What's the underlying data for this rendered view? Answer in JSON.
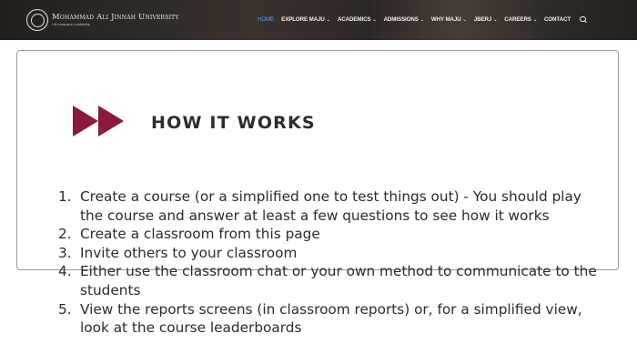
{
  "header": {
    "logo": {
      "name": "Mohammad Ali Jinnah University",
      "subtitle": "Life Lessons in Leadership"
    },
    "nav": [
      {
        "label": "HOME",
        "active": true,
        "dropdown": false
      },
      {
        "label": "EXPLORE MAJU",
        "active": false,
        "dropdown": true
      },
      {
        "label": "ACADEMICS",
        "active": false,
        "dropdown": true
      },
      {
        "label": "ADMISSIONS",
        "active": false,
        "dropdown": true
      },
      {
        "label": "WHY MAJU",
        "active": false,
        "dropdown": true
      },
      {
        "label": "JBERJ",
        "active": false,
        "dropdown": true
      },
      {
        "label": "CAREERS",
        "active": false,
        "dropdown": true
      },
      {
        "label": "CONTACT",
        "active": false,
        "dropdown": false
      }
    ],
    "search_icon": "search-icon"
  },
  "main": {
    "heading": "HOW IT WORKS",
    "icon": "double-play-icon",
    "accent_color": "#8b1a3d",
    "steps": [
      {
        "num": "1.",
        "text": "Create a course (or a simplified one to test things out) - You should play the course and answer at least a few questions to see how it works"
      },
      {
        "num": "2.",
        "text": "Create a classroom from this page"
      },
      {
        "num": "3.",
        "text": "Invite others to your classroom"
      },
      {
        "num": "4.",
        "text": "Either use the classroom chat or your own method to communicate to the students"
      },
      {
        "num": "5.",
        "text": "View the reports screens (in classroom reports) or, for a simplified view, look at the course leaderboards"
      }
    ]
  }
}
